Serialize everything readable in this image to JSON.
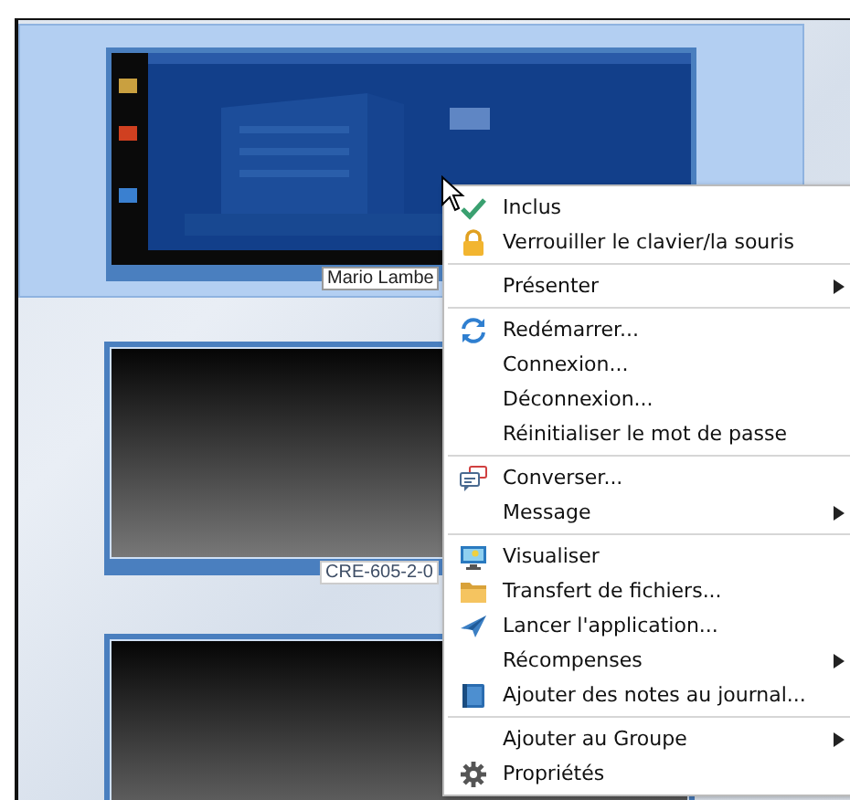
{
  "tiles": [
    {
      "label": "Mario Lambe",
      "selected": true,
      "kind": "picture"
    },
    {
      "label": "CRE-605-2-0",
      "selected": false,
      "kind": "blank"
    },
    {
      "selected": false,
      "kind": "blank"
    }
  ],
  "context_menu": {
    "items": [
      {
        "kind": "item",
        "label": "Inclus",
        "checked": true
      },
      {
        "kind": "item",
        "label": "Verrouiller le clavier/la souris"
      },
      {
        "kind": "separator"
      },
      {
        "kind": "item",
        "label": "Présenter",
        "submenu": true
      },
      {
        "kind": "separator"
      },
      {
        "kind": "item",
        "label": "Redémarrer..."
      },
      {
        "kind": "item",
        "label": "Connexion..."
      },
      {
        "kind": "item",
        "label": "Déconnexion..."
      },
      {
        "kind": "item",
        "label": "Réinitialiser le mot de passe"
      },
      {
        "kind": "separator"
      },
      {
        "kind": "item",
        "label": "Converser..."
      },
      {
        "kind": "item",
        "label": "Message",
        "submenu": true
      },
      {
        "kind": "separator"
      },
      {
        "kind": "item",
        "label": "Visualiser"
      },
      {
        "kind": "item",
        "label": "Transfert de fichiers..."
      },
      {
        "kind": "item",
        "label": "Lancer l'application..."
      },
      {
        "kind": "item",
        "label": "Récompenses",
        "submenu": true
      },
      {
        "kind": "item",
        "label": "Ajouter des notes au journal..."
      },
      {
        "kind": "separator"
      },
      {
        "kind": "item",
        "label": "Ajouter au Groupe",
        "submenu": true
      },
      {
        "kind": "item",
        "label": "Propriétés"
      }
    ]
  }
}
